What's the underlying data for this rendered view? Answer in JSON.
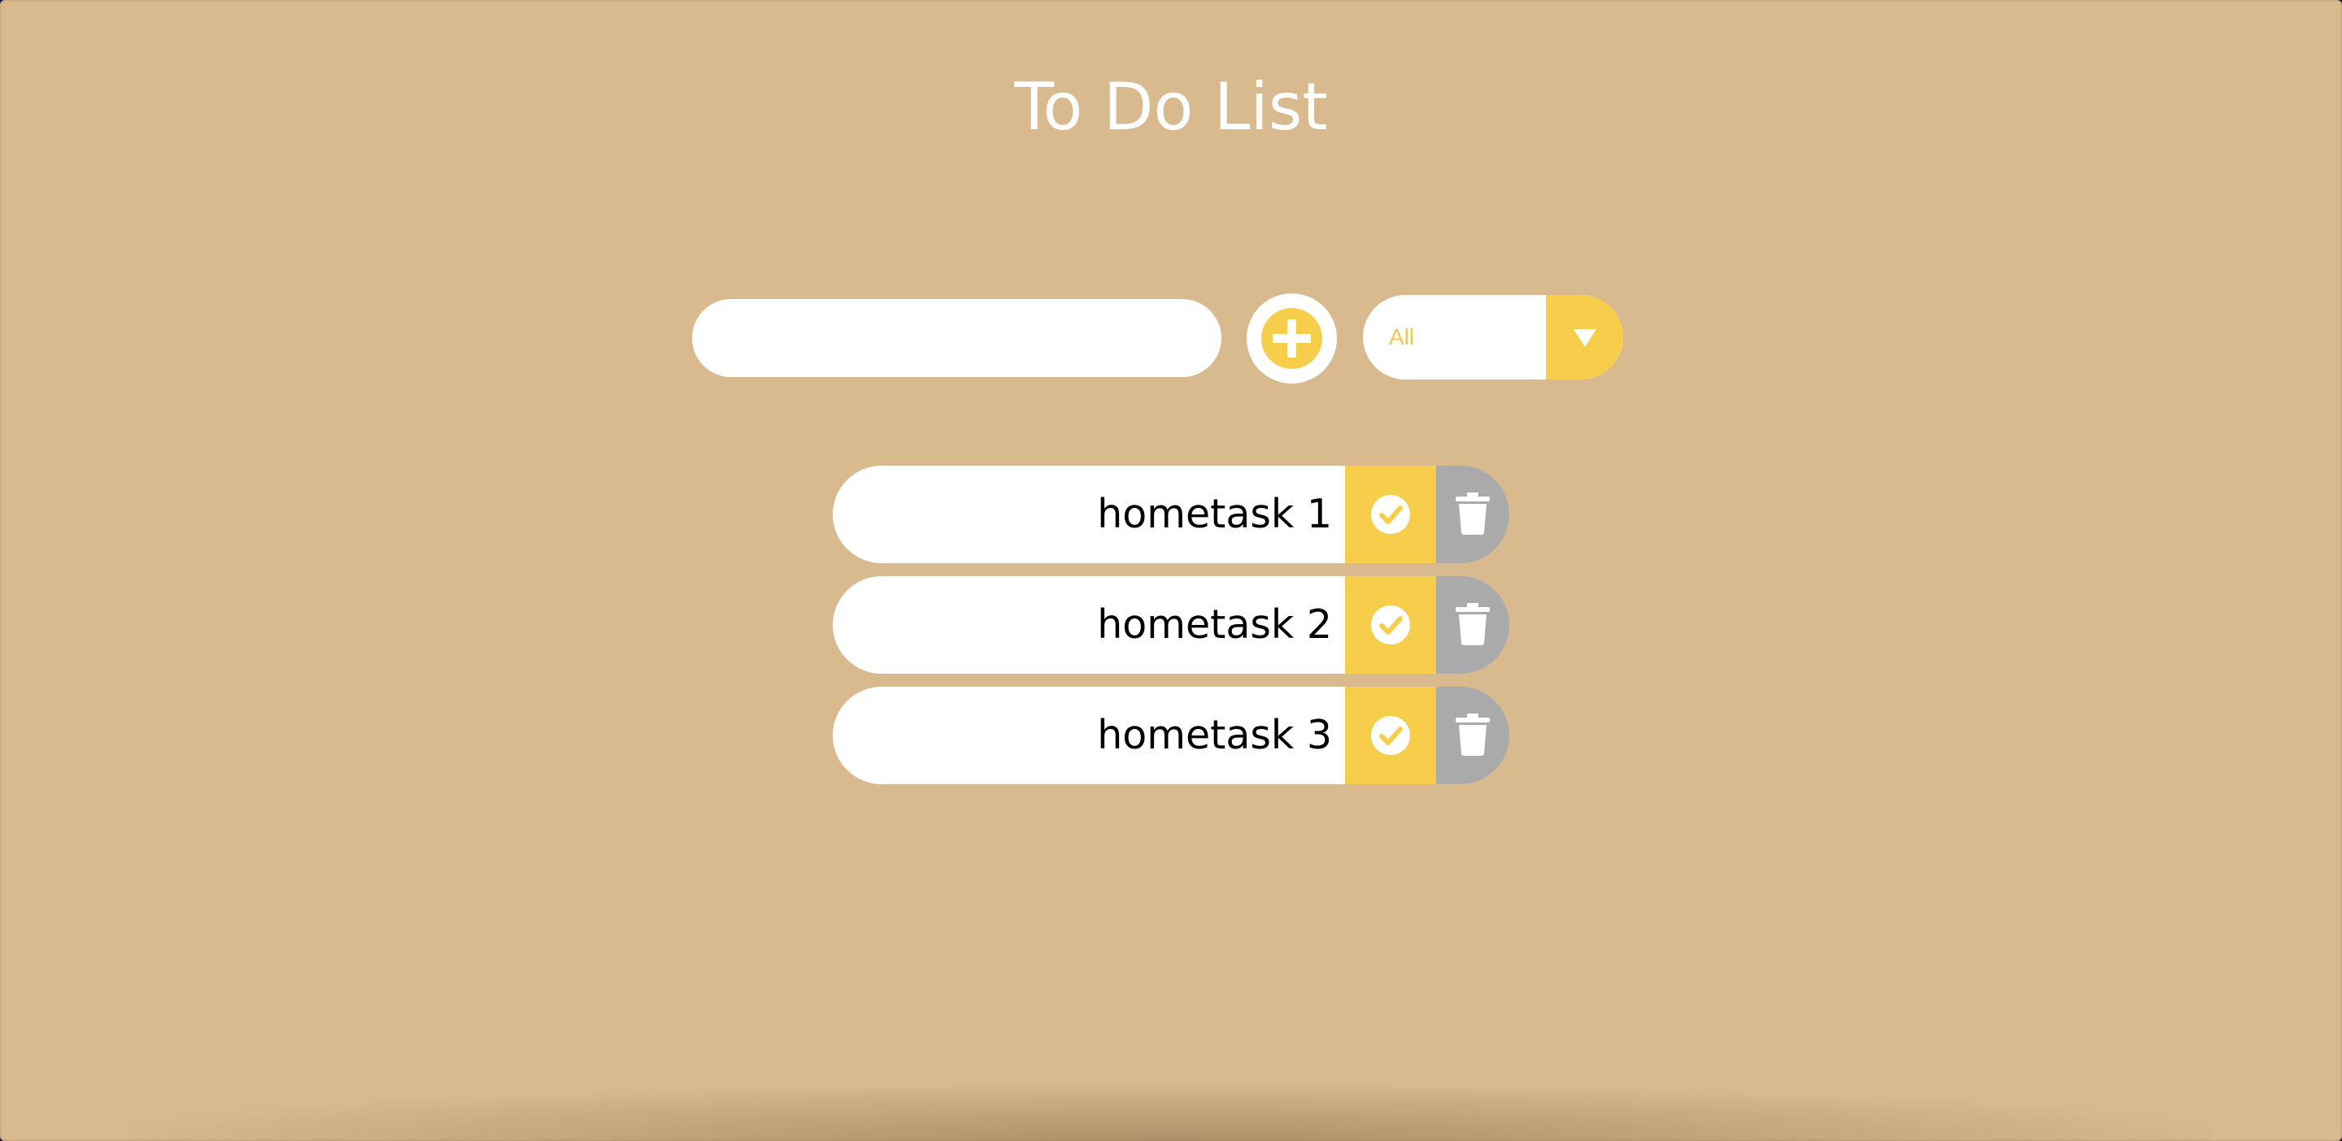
{
  "header": {
    "title": "To Do List"
  },
  "todo_form": {
    "input_value": "",
    "input_placeholder": "",
    "add_icon": "plus-circle-icon",
    "filter": {
      "selected": "All",
      "arrow_icon": "triangle-down-icon"
    }
  },
  "todos": [
    {
      "text": "hometask 1",
      "complete_icon": "check-circle-icon",
      "delete_icon": "trash-icon"
    },
    {
      "text": "hometask 2",
      "complete_icon": "check-circle-icon",
      "delete_icon": "trash-icon"
    },
    {
      "text": "hometask 3",
      "complete_icon": "check-circle-icon",
      "delete_icon": "trash-icon"
    }
  ],
  "colors": {
    "background": "#d9b98e",
    "accent": "#f7cd4c",
    "delete": "#aaaaaa",
    "surface": "#ffffff",
    "text": "#000000"
  }
}
